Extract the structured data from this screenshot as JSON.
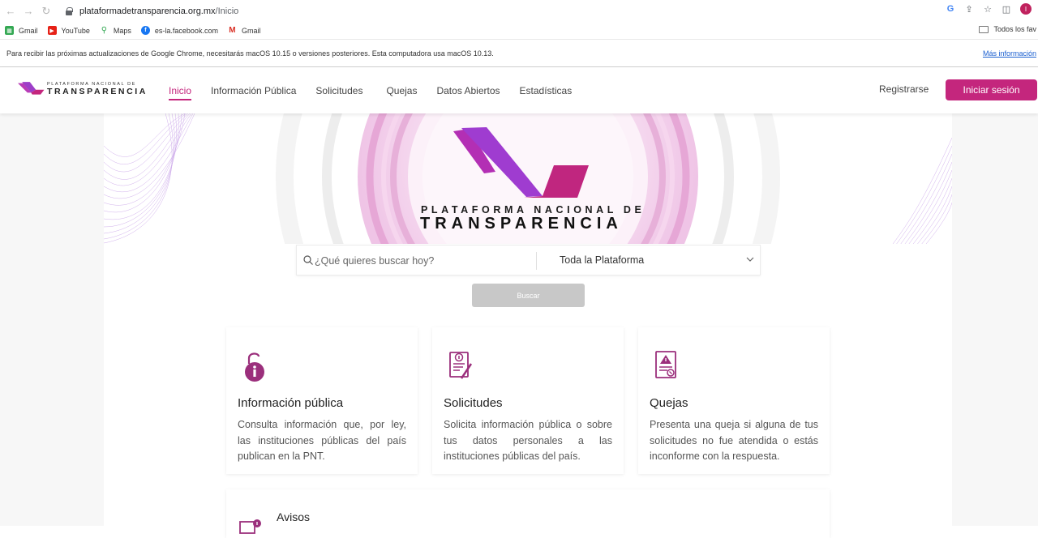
{
  "browser": {
    "url_host": "plataformadetransparencia.org.mx",
    "url_path": "/Inicio",
    "profile_initial": "I",
    "bookmarks": [
      {
        "label": "Gmail",
        "color": "#34a853"
      },
      {
        "label": "YouTube",
        "color": "#e62117"
      },
      {
        "label": "Maps",
        "color": "#34a853"
      },
      {
        "label": "es-la.facebook.com",
        "color": "#1877f2"
      },
      {
        "label": "Gmail",
        "color": "#d93025"
      }
    ],
    "all_bookmarks_label": "Todos los fav",
    "infobar_message": "Para recibir las próximas actualizaciones de Google Chrome, necesitarás macOS 10.15 o versiones posteriores. Esta computadora usa macOS 10.13.",
    "infobar_link": "Más información"
  },
  "site": {
    "logo_small": "PLATAFORMA NACIONAL DE",
    "logo_big": "TRANSPARENCIA",
    "menu": [
      "Inicio",
      "Información Pública",
      "Solicitudes",
      "Quejas",
      "Datos Abiertos",
      "Estadísticas"
    ],
    "active_menu": "Inicio",
    "register_label": "Registrarse",
    "login_label": "Iniciar sesión",
    "accent_color": "#c4267d"
  },
  "hero": {
    "title_small": "PLATAFORMA NACIONAL DE",
    "title_big": "TRANSPARENCIA"
  },
  "search": {
    "placeholder": "¿Qué quieres buscar hoy?",
    "scope": "Toda la Plataforma",
    "button_label": "Buscar"
  },
  "cards": [
    {
      "icon": "lock-info-icon",
      "title": "Información pública",
      "text": "Consulta información que, por ley, las instituciones públicas del país publican en la PNT."
    },
    {
      "icon": "document-edit-icon",
      "title": "Solicitudes",
      "text": "Solicita información pública o sobre tus datos personales a las instituciones públicas del país."
    },
    {
      "icon": "complaint-document-icon",
      "title": "Quejas",
      "text": "Presenta una queja si alguna de tus solicitudes no fue atendida o estás inconforme con la respuesta."
    }
  ],
  "avisos": {
    "title": "Avisos"
  }
}
